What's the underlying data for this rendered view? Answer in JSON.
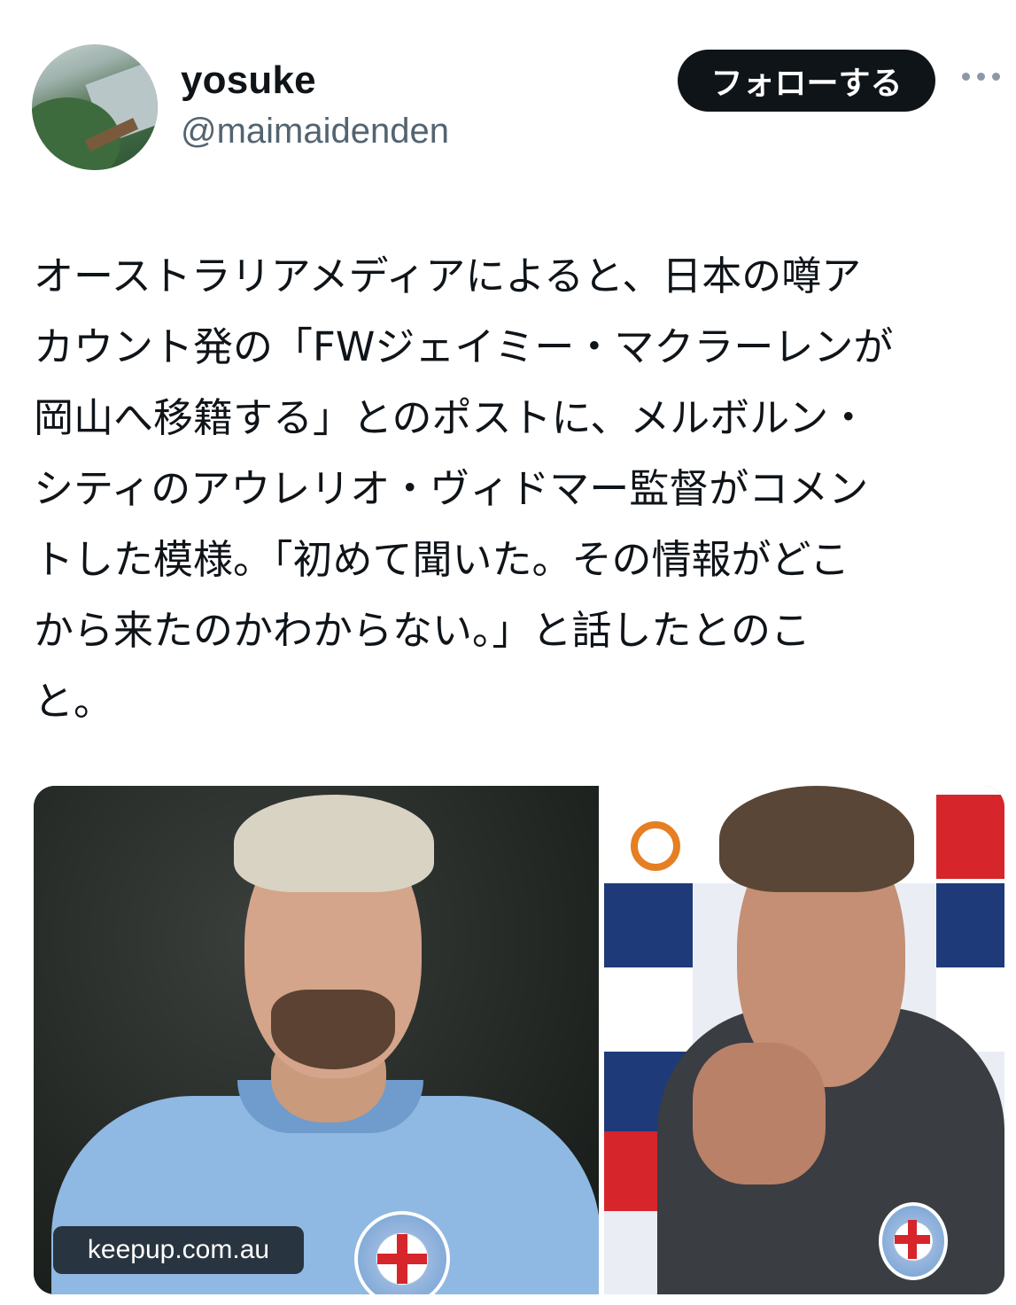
{
  "author": {
    "display_name": "yosuke",
    "handle": "@maimaidenden"
  },
  "actions": {
    "follow_label": "フォローする"
  },
  "icons": {
    "more": "more-horizontal-icon"
  },
  "tweet": {
    "lines": [
      "オーストラリアメディアによると、日本の噂ア",
      "カウント発の「FWジェイミー・マクラーレンが",
      "岡山へ移籍する」とのポストに、メルボルン・",
      "シティのアウレリオ・ヴィドマー監督がコメン",
      "トした模様。「初めて聞いた。その情報がどこ",
      "から来たのかわからない。」と話したとのこ",
      "と。"
    ]
  },
  "media": {
    "source_label": "keepup.com.au"
  },
  "colors": {
    "text": "#0f1419",
    "secondary": "#536471",
    "button_bg": "#0f1419",
    "button_text": "#ffffff",
    "jersey_sky_blue": "#8fb9e3"
  }
}
